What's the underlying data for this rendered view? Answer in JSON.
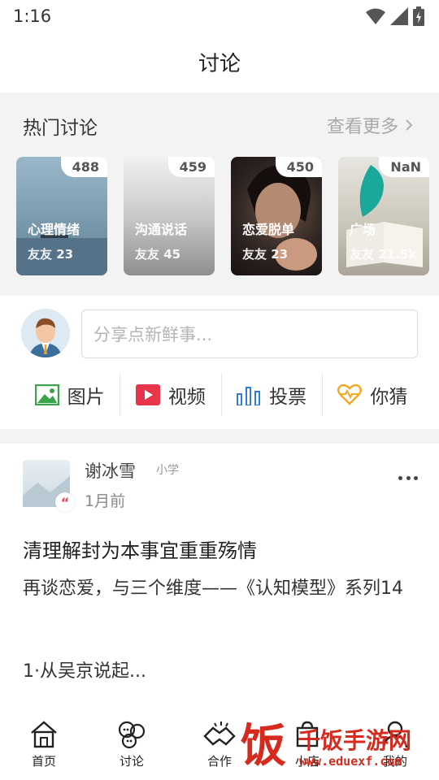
{
  "status_bar": {
    "time": "1:16"
  },
  "header": {
    "title": "讨论"
  },
  "hot_section": {
    "title": "热门讨论",
    "more_label": "查看更多",
    "cards": [
      {
        "count": "488",
        "name": "心理情绪",
        "members": "友友 23"
      },
      {
        "count": "459",
        "name": "沟通说话",
        "members": "友友 45"
      },
      {
        "count": "450",
        "name": "恋爱脱单",
        "members": "友友 23"
      },
      {
        "count": "NaN",
        "name": "广场",
        "members": "友友 21.5k"
      }
    ]
  },
  "compose": {
    "placeholder": "分享点新鲜事...",
    "actions": [
      {
        "label": "图片",
        "icon": "image-icon",
        "color": "#3aa24a"
      },
      {
        "label": "视频",
        "icon": "video-icon",
        "color": "#e8354a"
      },
      {
        "label": "投票",
        "icon": "bar-chart-icon",
        "color": "#2f7be0"
      },
      {
        "label": "你猜",
        "icon": "heart-pulse-icon",
        "color": "#f5a623"
      }
    ]
  },
  "post": {
    "author": "谢冰雪",
    "tag": "小学",
    "time": "1月前",
    "title": "清理解封为本事宜重重殇情",
    "body": "再谈恋爱，与三个维度——《认知模型》系列14",
    "snippet": "1·从吴京说起..."
  },
  "bottom_nav": [
    {
      "label": "首页",
      "icon": "house-icon"
    },
    {
      "label": "讨论",
      "icon": "chat-bubbles-icon"
    },
    {
      "label": "合作",
      "icon": "handshake-icon"
    },
    {
      "label": "小店",
      "icon": "shop-bag-icon"
    },
    {
      "label": "我的",
      "icon": "person-icon"
    }
  ],
  "watermark": {
    "big_char": "饭",
    "name": "千饭手游网",
    "url": "www.eduexf.com"
  },
  "colors": {
    "accent_red": "#e0485a",
    "section_bg": "#f3f3f3"
  }
}
